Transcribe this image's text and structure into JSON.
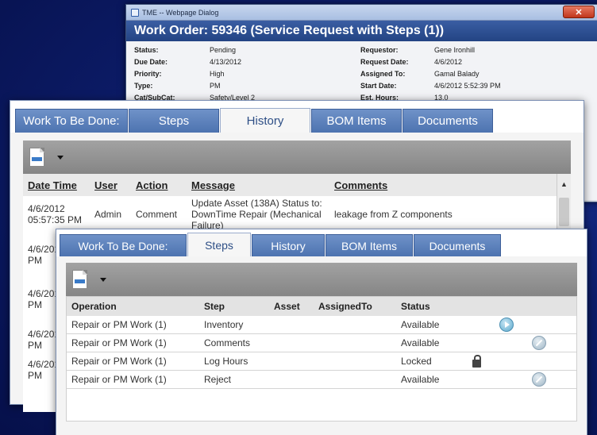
{
  "dialog": {
    "window_title": "TME -- Webpage Dialog",
    "close_glyph": "✕",
    "header": "Work Order: 59346 (Service Request with Steps (1))",
    "fields_left": [
      {
        "label": "Status:",
        "value": "Pending"
      },
      {
        "label": "Due Date:",
        "value": "4/13/2012"
      },
      {
        "label": "Priority:",
        "value": "High"
      },
      {
        "label": "Type:",
        "value": "PM"
      },
      {
        "label": "Cat/SubCat:",
        "value": "Safety/Level 2"
      }
    ],
    "fields_right": [
      {
        "label": "Requestor:",
        "value": "Gene Ironhill"
      },
      {
        "label": "Request Date:",
        "value": "4/6/2012"
      },
      {
        "label": "Assigned To:",
        "value": "Gamal Balady"
      },
      {
        "label": "Start Date:",
        "value": "4/6/2012 5:52:39 PM"
      },
      {
        "label": "Est. Hours:",
        "value": "13.0"
      }
    ]
  },
  "history_window": {
    "tabs": [
      "Work To Be Done:",
      "Steps",
      "History",
      "BOM Items",
      "Documents"
    ],
    "active_tab": "History",
    "columns": [
      "Date Time",
      "User",
      "Action",
      "Message",
      "Comments"
    ],
    "rows": [
      {
        "date": "4/6/2012 05:57:35 PM",
        "user": "Admin",
        "action": "Comment",
        "message": "Update Asset (138A) Status to: DownTime Repair (Mechanical Failure)",
        "comments": "leakage from Z components"
      },
      {
        "date": "4/6/2012 05:56 PM",
        "user": "",
        "action": "",
        "message": "",
        "comments": ""
      },
      {
        "date": "4/6/2012 05:53 PM",
        "user": "",
        "action": "",
        "message": "",
        "comments": ""
      },
      {
        "date": "4/6/2012 05:52 PM",
        "user": "",
        "action": "",
        "message": "",
        "comments": ""
      },
      {
        "date": "4/6/2012 05:52 PM",
        "user": "",
        "action": "",
        "message": "",
        "comments": ""
      }
    ],
    "scroll_up_glyph": "▲"
  },
  "steps_window": {
    "tabs": [
      "Work To Be Done:",
      "Steps",
      "History",
      "BOM Items",
      "Documents"
    ],
    "active_tab": "Steps",
    "columns": [
      "Operation",
      "Step",
      "Asset",
      "AssignedTo",
      "Status"
    ],
    "rows": [
      {
        "operation": "Repair or PM Work (1)",
        "step": "Inventory",
        "asset": "",
        "assigned": "",
        "status": "Available",
        "icon": "play-icon"
      },
      {
        "operation": "Repair or PM Work (1)",
        "step": "Comments",
        "asset": "",
        "assigned": "",
        "status": "Available",
        "icon": "no-icon"
      },
      {
        "operation": "Repair or PM Work (1)",
        "step": "Log Hours",
        "asset": "",
        "assigned": "",
        "status": "Locked",
        "icon": "lock-icon"
      },
      {
        "operation": "Repair or PM Work (1)",
        "step": "Reject",
        "asset": "",
        "assigned": "",
        "status": "Available",
        "icon": "no-icon"
      }
    ]
  }
}
